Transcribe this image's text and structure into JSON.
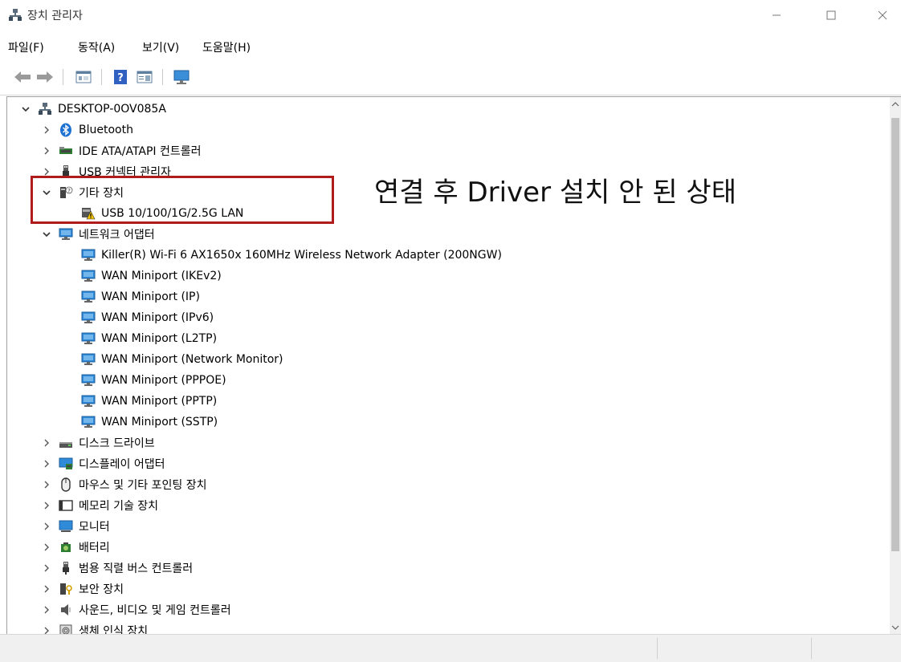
{
  "window": {
    "title": "장치 관리자"
  },
  "menu": [
    {
      "label": "파일(F)"
    },
    {
      "label": "동작(A)"
    },
    {
      "label": "보기(V)"
    },
    {
      "label": "도움말(H)"
    }
  ],
  "tree": [
    {
      "label": "DESKTOP-0OV085A",
      "icon": "computer-icon",
      "expanded": true
    },
    {
      "label": "Bluetooth",
      "icon": "bluetooth-icon"
    },
    {
      "label": "IDE ATA/ATAPI 컨트롤러",
      "icon": "ide-controller-icon"
    },
    {
      "label": "USB 커넥터 관리자",
      "icon": "usb-connector-icon"
    },
    {
      "label": "기타 장치",
      "icon": "unknown-device-icon",
      "expanded": true
    },
    {
      "label": "USB 10/100/1G/2.5G LAN",
      "icon": "warning-device-icon"
    },
    {
      "label": "네트워크 어댑터",
      "icon": "network-adapter-icon",
      "expanded": true
    },
    {
      "label": "Killer(R) Wi-Fi 6 AX1650x 160MHz Wireless Network Adapter (200NGW)",
      "icon": "network-adapter-icon"
    },
    {
      "label": "WAN Miniport (IKEv2)",
      "icon": "network-adapter-icon"
    },
    {
      "label": "WAN Miniport (IP)",
      "icon": "network-adapter-icon"
    },
    {
      "label": "WAN Miniport (IPv6)",
      "icon": "network-adapter-icon"
    },
    {
      "label": "WAN Miniport (L2TP)",
      "icon": "network-adapter-icon"
    },
    {
      "label": "WAN Miniport (Network Monitor)",
      "icon": "network-adapter-icon"
    },
    {
      "label": "WAN Miniport (PPPOE)",
      "icon": "network-adapter-icon"
    },
    {
      "label": "WAN Miniport (PPTP)",
      "icon": "network-adapter-icon"
    },
    {
      "label": "WAN Miniport (SSTP)",
      "icon": "network-adapter-icon"
    },
    {
      "label": "디스크 드라이브",
      "icon": "disk-drive-icon"
    },
    {
      "label": "디스플레이 어댑터",
      "icon": "display-adapter-icon"
    },
    {
      "label": "마우스 및 기타 포인팅 장치",
      "icon": "mouse-icon"
    },
    {
      "label": "메모리 기술 장치",
      "icon": "memory-device-icon"
    },
    {
      "label": "모니터",
      "icon": "monitor-icon"
    },
    {
      "label": "배터리",
      "icon": "battery-icon"
    },
    {
      "label": "범용 직렬 버스 컨트롤러",
      "icon": "usb-controller-icon"
    },
    {
      "label": "보안 장치",
      "icon": "security-device-icon"
    },
    {
      "label": "사운드, 비디오 및 게임 컨트롤러",
      "icon": "sound-icon"
    },
    {
      "label": "생체 인식 장치",
      "icon": "biometric-icon"
    }
  ],
  "annotation": {
    "text": "연결 후 Driver 설치 안 된 상태",
    "color": "#b01c1c"
  }
}
